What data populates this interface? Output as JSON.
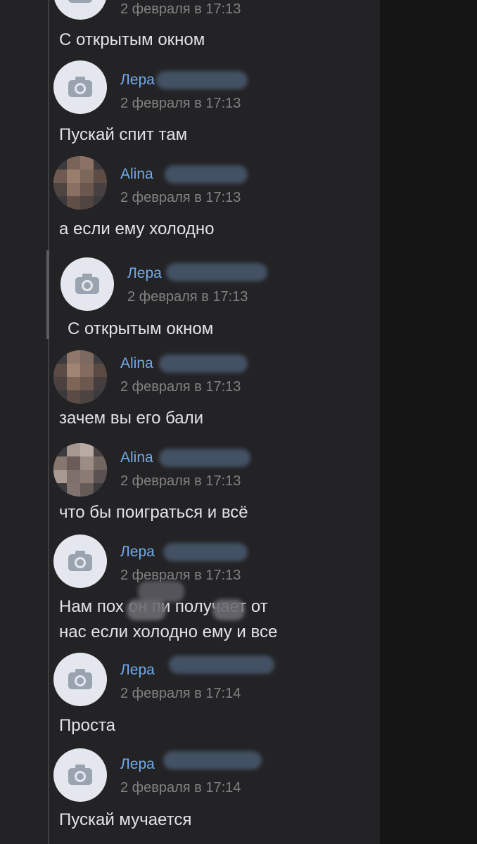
{
  "messages": [
    {
      "name": "",
      "time": "2 февраля в 17:13",
      "lines": [
        "С открытым окном"
      ],
      "avatar": "camera-placeholder"
    },
    {
      "name": "Лера",
      "time": "2 февраля в 17:13",
      "lines": [
        "Пускай спит там"
      ],
      "avatar": "camera-placeholder"
    },
    {
      "name": "Alina",
      "time": "2 февраля в 17:13",
      "lines": [
        "а если ему холодно"
      ],
      "avatar": "pixelated-photo"
    },
    {
      "name": "Лера",
      "time": "2 февраля в 17:13",
      "lines": [
        "С открытым окном"
      ],
      "avatar": "camera-placeholder",
      "quoted": true
    },
    {
      "name": "Alina",
      "time": "2 февраля в 17:13",
      "lines": [
        "зачем вы его бали"
      ],
      "avatar": "pixelated-photo"
    },
    {
      "name": "Alina",
      "time": "2 февраля в 17:13",
      "lines": [
        "что бы поиграться и всё"
      ],
      "avatar": "pixelated-photo"
    },
    {
      "name": "Лера",
      "time": "2 февраля в 17:13",
      "lines": [
        "Нам пох   он пи    получает от",
        "нас  если холодно ему и все"
      ],
      "avatar": "camera-placeholder"
    },
    {
      "name": "Лера",
      "time": "2 февраля в 17:14",
      "lines": [
        "Проста"
      ],
      "avatar": "camera-placeholder"
    },
    {
      "name": "Лера",
      "time": "2 февраля в 17:14",
      "lines": [
        "Пускай мучается"
      ],
      "avatar": "camera-placeholder"
    }
  ],
  "colors": {
    "background": "#151515",
    "panel": "#232325",
    "name": "#71aaeb",
    "time": "#828282",
    "text": "#e1e3e6"
  }
}
